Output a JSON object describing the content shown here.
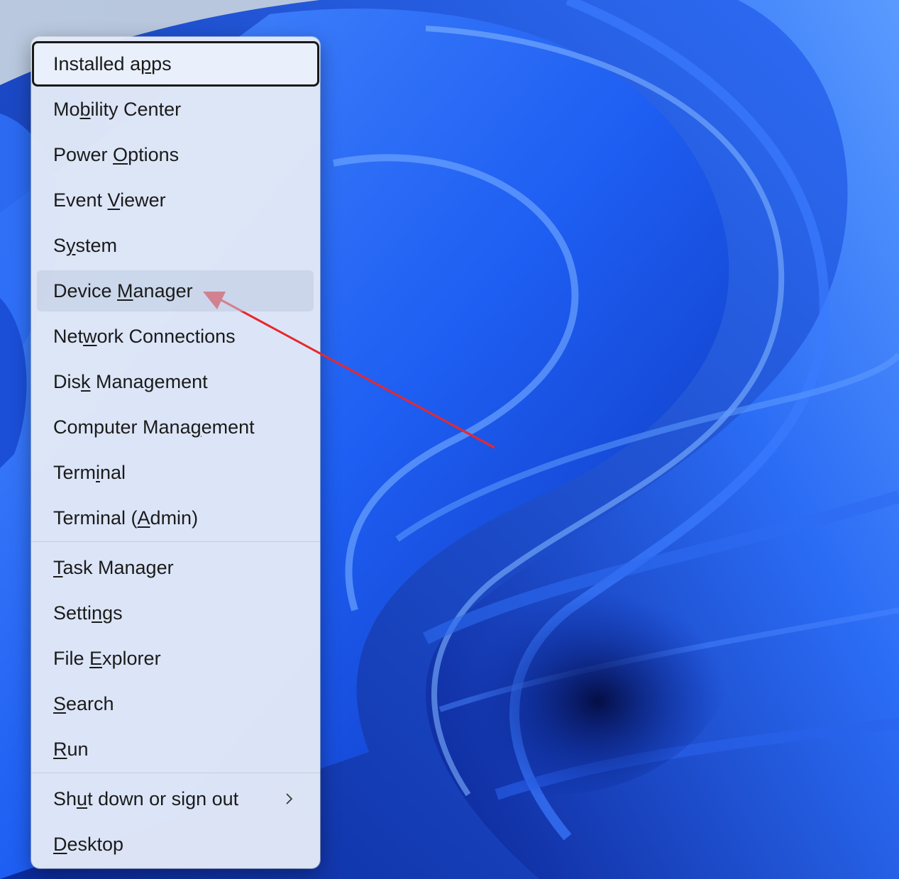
{
  "menu": {
    "groups": [
      {
        "items": [
          {
            "id": "installed-apps",
            "before": "Installed a",
            "key": "p",
            "after": "ps",
            "state": "focused"
          },
          {
            "id": "mobility-center",
            "before": "Mo",
            "key": "b",
            "after": "ility Center"
          },
          {
            "id": "power-options",
            "before": "Power ",
            "key": "O",
            "after": "ptions"
          },
          {
            "id": "event-viewer",
            "before": "Event ",
            "key": "V",
            "after": "iewer"
          },
          {
            "id": "system",
            "before": "S",
            "key": "y",
            "after": "stem"
          },
          {
            "id": "device-manager",
            "before": "Device ",
            "key": "M",
            "after": "anager",
            "state": "hovered"
          },
          {
            "id": "network-connections",
            "before": "Net",
            "key": "w",
            "after": "ork Connections"
          },
          {
            "id": "disk-management",
            "before": "Dis",
            "key": "k",
            "after": " Management"
          },
          {
            "id": "computer-management",
            "before": "Computer Mana",
            "key": "g",
            "after": "ement"
          },
          {
            "id": "terminal",
            "before": "Term",
            "key": "i",
            "after": "nal"
          },
          {
            "id": "terminal-admin",
            "before": "Terminal (",
            "key": "A",
            "after": "dmin)"
          }
        ]
      },
      {
        "items": [
          {
            "id": "task-manager",
            "before": "",
            "key": "T",
            "after": "ask Manager"
          },
          {
            "id": "settings",
            "before": "Setti",
            "key": "n",
            "after": "gs"
          },
          {
            "id": "file-explorer",
            "before": "File ",
            "key": "E",
            "after": "xplorer"
          },
          {
            "id": "search",
            "before": "",
            "key": "S",
            "after": "earch"
          },
          {
            "id": "run",
            "before": "",
            "key": "R",
            "after": "un"
          }
        ]
      },
      {
        "items": [
          {
            "id": "shut-down-or-sign-out",
            "before": "Sh",
            "key": "u",
            "after": "t down or sign out",
            "submenu": true
          },
          {
            "id": "desktop",
            "before": "",
            "key": "D",
            "after": "esktop"
          }
        ]
      }
    ],
    "icons": {
      "submenu": "chevron-right-icon"
    }
  },
  "annotation": {
    "type": "arrow",
    "points_to": "device-manager",
    "color": "#e8282b"
  },
  "colors": {
    "menu_background": "#e2e9f7",
    "focus_border": "#1a1a1a",
    "wallpaper_primary": "#1d5cf0",
    "wallpaper_deep": "#06176b"
  }
}
